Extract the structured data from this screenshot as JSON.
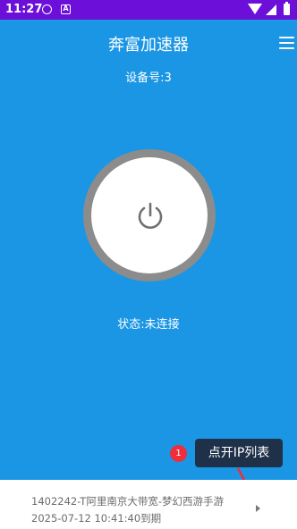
{
  "statusbar": {
    "time": "11:27",
    "icon2": "A"
  },
  "header": {
    "title": "奔富加速器",
    "device": "设备号:3"
  },
  "power": {
    "icon": "power-icon"
  },
  "status_text": "状态:未连接",
  "guide": {
    "badge": "1",
    "tip": "点开IP列表"
  },
  "server": {
    "name": "1402242-T阿里南京大带宽-梦幻西游手游",
    "expiry": "2025-07-12 10:41:40到期"
  },
  "colors": {
    "primary": "#1a96e4",
    "statusbar": "#6b0fd9",
    "badge": "#ee2e3c",
    "tip": "#1f3149"
  }
}
